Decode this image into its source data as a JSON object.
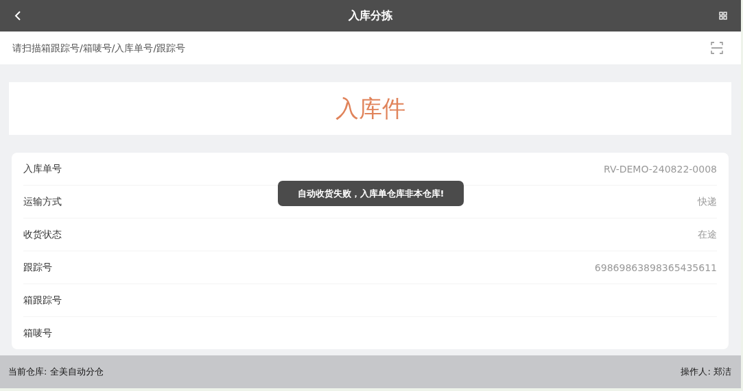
{
  "header": {
    "title": "入库分拣"
  },
  "scan": {
    "placeholder": "请扫描箱跟踪号/箱唛号/入库单号/跟踪号"
  },
  "banner": {
    "text": "入库件"
  },
  "details": [
    {
      "label": "入库单号",
      "value": "RV-DEMO-240822-0008"
    },
    {
      "label": "运输方式",
      "value": "快递"
    },
    {
      "label": "收货状态",
      "value": "在途"
    },
    {
      "label": "跟踪号",
      "value": "69869863898365435611"
    },
    {
      "label": "箱跟踪号"
    },
    {
      "label": "箱唛号"
    }
  ],
  "toast": {
    "text": "自动收货失败，入库单仓库非本仓库!"
  },
  "footer": {
    "warehouse": "当前仓库: 全美自动分仓",
    "operator": "操作人: 郑洁"
  }
}
